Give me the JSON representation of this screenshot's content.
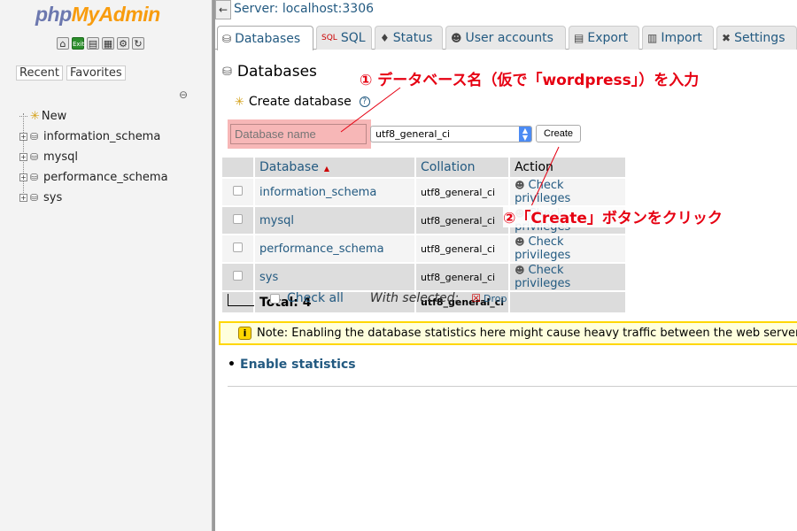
{
  "sidebar": {
    "logo_php": "php",
    "logo_myadmin": "MyAdmin",
    "nav_icons": [
      "home-icon",
      "exit-icon",
      "query-icon",
      "docs-icon",
      "settings-icon",
      "reload-icon"
    ],
    "tab_recent": "Recent",
    "tab_favorites": "Favorites",
    "tree": {
      "new": "New",
      "items": [
        "information_schema",
        "mysql",
        "performance_schema",
        "sys"
      ]
    }
  },
  "header": {
    "back_arrow": "←",
    "server": "Server: localhost:3306"
  },
  "tabs": [
    {
      "label": "Databases",
      "icon": "database-icon",
      "active": true
    },
    {
      "label": "SQL",
      "icon": "sql-icon"
    },
    {
      "label": "Status",
      "icon": "status-icon"
    },
    {
      "label": "User accounts",
      "icon": "users-icon"
    },
    {
      "label": "Export",
      "icon": "export-icon"
    },
    {
      "label": "Import",
      "icon": "import-icon"
    },
    {
      "label": "Settings",
      "icon": "settings-icon"
    }
  ],
  "main": {
    "heading": "Databases",
    "create_heading": "Create database",
    "help_mark": "?",
    "dbname_placeholder": "Database name",
    "collation_value": "utf8_general_ci",
    "create_button": "Create",
    "table": {
      "headers": {
        "database": "Database",
        "collation": "Collation",
        "action": "Action"
      },
      "rows": [
        {
          "name": "information_schema",
          "collation": "utf8_general_ci",
          "action": "Check privileges"
        },
        {
          "name": "mysql",
          "collation": "utf8_general_ci",
          "action": "Check privileges"
        },
        {
          "name": "performance_schema",
          "collation": "utf8_general_ci",
          "action": "Check privileges"
        },
        {
          "name": "sys",
          "collation": "utf8_general_ci",
          "action": "Check privileges"
        }
      ],
      "total_label": "Total: 4",
      "total_collation": "utf8_general_ci"
    },
    "check_all": "Check all",
    "with_selected": "With selected:",
    "drop": "Drop",
    "notice_icon": "i",
    "notice": "Note: Enabling the database statistics here might cause heavy traffic between the web server",
    "enable_stats": "Enable statistics"
  },
  "annotations": {
    "step1": "① データベース名（仮で「wordpress」）を入力",
    "step2": "②「Create」ボタンをクリック",
    "color": "#e60012"
  }
}
